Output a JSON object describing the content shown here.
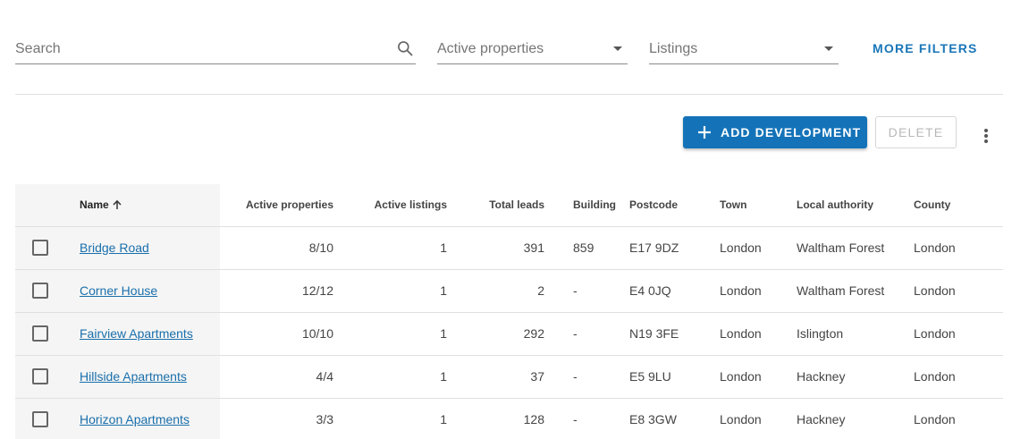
{
  "filters": {
    "search_placeholder": "Search",
    "select1_value": "Active properties",
    "select2_value": "Listings",
    "more_filters_label": "MORE FILTERS"
  },
  "toolbar": {
    "add_label": "ADD DEVELOPMENT",
    "delete_label": "DELETE"
  },
  "colors": {
    "primary": "#1473b8",
    "link": "#1a6fab"
  },
  "table": {
    "headers": {
      "name": "Name",
      "active_properties": "Active properties",
      "active_listings": "Active listings",
      "total_leads": "Total leads",
      "building": "Building",
      "postcode": "Postcode",
      "town": "Town",
      "local_authority": "Local authority",
      "county": "County"
    },
    "rows": [
      {
        "name": "Bridge Road",
        "active_properties": "8/10",
        "active_listings": "1",
        "total_leads": "391",
        "building": "859",
        "postcode": "E17 9DZ",
        "town": "London",
        "local_authority": "Waltham Forest",
        "county": "London"
      },
      {
        "name": "Corner House",
        "active_properties": "12/12",
        "active_listings": "1",
        "total_leads": "2",
        "building": "-",
        "postcode": "E4 0JQ",
        "town": "London",
        "local_authority": "Waltham Forest",
        "county": "London"
      },
      {
        "name": "Fairview Apartments",
        "active_properties": "10/10",
        "active_listings": "1",
        "total_leads": "292",
        "building": "-",
        "postcode": "N19 3FE",
        "town": "London",
        "local_authority": "Islington",
        "county": "London"
      },
      {
        "name": "Hillside Apartments",
        "active_properties": "4/4",
        "active_listings": "1",
        "total_leads": "37",
        "building": "-",
        "postcode": "E5 9LU",
        "town": "London",
        "local_authority": "Hackney",
        "county": "London"
      },
      {
        "name": "Horizon Apartments",
        "active_properties": "3/3",
        "active_listings": "1",
        "total_leads": "128",
        "building": "-",
        "postcode": "E8 3GW",
        "town": "London",
        "local_authority": "Hackney",
        "county": "London"
      }
    ]
  }
}
